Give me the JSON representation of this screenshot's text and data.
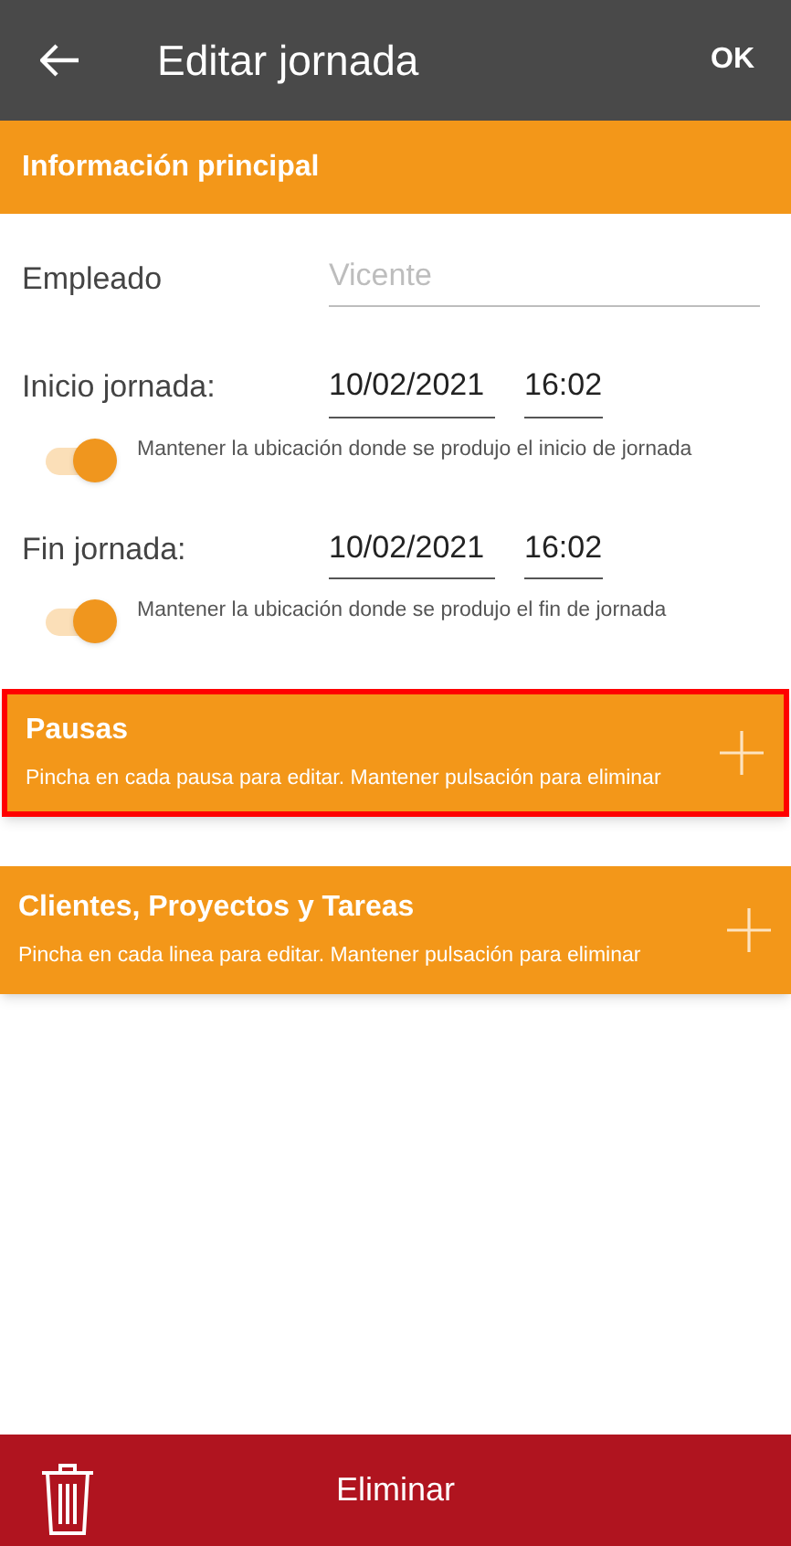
{
  "app_bar": {
    "title": "Editar jornada",
    "action": "OK"
  },
  "main_section": {
    "title": "Información principal"
  },
  "employee": {
    "label": "Empleado",
    "placeholder": "Vicente"
  },
  "periods": [
    {
      "label": "Inicio jornada:",
      "date": "10/02/2021",
      "time": "16:02",
      "toggle_label": "Mantener la ubicación donde se produjo el inicio de jornada",
      "on": true
    },
    {
      "label": "Fin jornada:",
      "date": "10/02/2021",
      "time": "16:02",
      "toggle_label": "Mantener la ubicación donde se produjo el fin de jornada",
      "on": true
    }
  ],
  "sections": [
    {
      "title": "Pausas",
      "hint": "Pincha en cada pausa para editar. Mantener pulsación para eliminar",
      "highlighted": true
    },
    {
      "title": "Clientes, Proyectos y Tareas",
      "hint": "Pincha en cada linea para editar. Mantener pulsación para eliminar",
      "highlighted": false
    }
  ],
  "footer": {
    "button": "Eliminar"
  }
}
